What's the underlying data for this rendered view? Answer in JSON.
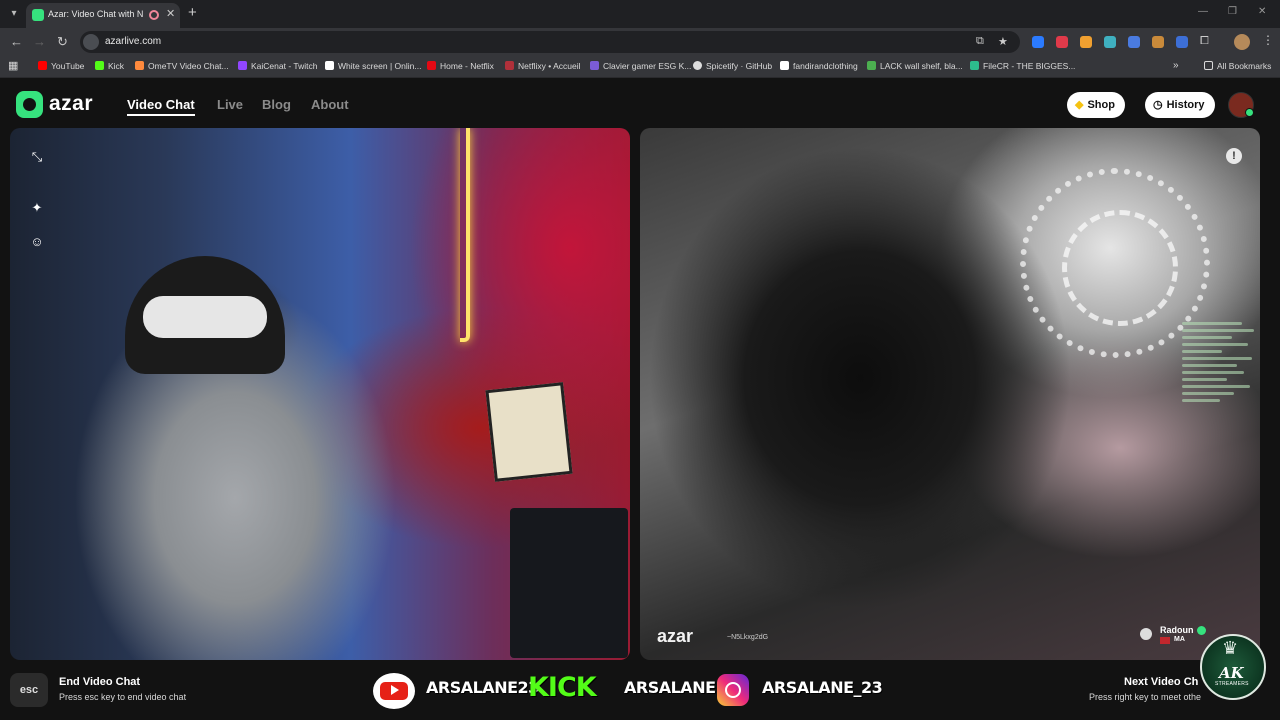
{
  "browser": {
    "tab": {
      "title": "Azar: Video Chat with New",
      "close": "✕"
    },
    "new_tab": "+",
    "url": "azarlive.com",
    "bookmarks": [
      {
        "label": "YouTube",
        "color": "#ff0000"
      },
      {
        "label": "Kick",
        "color": "#53fc18"
      },
      {
        "label": "OmeTV Video Chat...",
        "color": "#ff8a3d"
      },
      {
        "label": "KaiCenat - Twitch",
        "color": "#9146ff"
      },
      {
        "label": "White screen | Onlin...",
        "color": "#ffffff"
      },
      {
        "label": "Home - Netflix",
        "color": "#e50914"
      },
      {
        "label": "Netflixy • Accueil",
        "color": "#b0303a"
      },
      {
        "label": "Clavier gamer ESG K...",
        "color": "#7b5cd6"
      },
      {
        "label": "Spicetify · GitHub",
        "color": "#dddddd"
      },
      {
        "label": "fandirandclothing",
        "color": "#ffffff"
      },
      {
        "label": "LACK wall shelf, bla...",
        "color": "#4caf50"
      },
      {
        "label": "FileCR - THE BIGGES...",
        "color": "#2dbd8c"
      }
    ],
    "all_bookmarks": "All Bookmarks"
  },
  "azar": {
    "logo_text": "azar",
    "nav": [
      "Video Chat",
      "Live",
      "Blog",
      "About"
    ],
    "shop_label": "Shop",
    "history_label": "History",
    "watermark": "azar",
    "watermark_id": "~N5Lkxg2dG",
    "partner": {
      "name": "Radoun",
      "country": "MA"
    },
    "report_glyph": "!",
    "footer": {
      "esc_key": "esc",
      "end_title": "End Video Chat",
      "end_sub": "Press esc key to end video chat",
      "next_title": "Next Video Ch",
      "next_sub": "Press right key to meet othe"
    }
  },
  "overlay": {
    "youtube_handle": "ARSALANE23",
    "kick_label": "KICK",
    "kick_handle": "ARSALANE1",
    "instagram_handle": "ARSALANE_23",
    "ak_logo": "AK",
    "ak_sub": "STREAMERS"
  },
  "colors": {
    "brand": "#36e27e",
    "page_bg": "#121212",
    "kick": "#53fc18"
  }
}
